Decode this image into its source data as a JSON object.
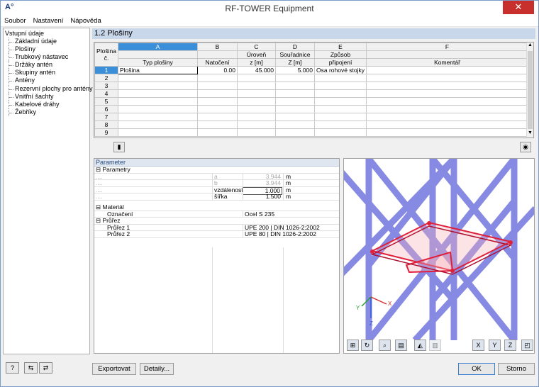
{
  "window": {
    "title": "RF-TOWER Equipment",
    "close": "✕"
  },
  "menu": [
    "Soubor",
    "Nastavení",
    "Nápověda"
  ],
  "tree": {
    "root": "Vstupní údaje",
    "items": [
      "Základní údaje",
      "Plošiny",
      "Trubkový nástavec",
      "Držáky antén",
      "Skupiny antén",
      "Antény",
      "Rezervní plochy pro antény",
      "Vnitřní šachty",
      "Kabelové dráhy",
      "Žebříky"
    ]
  },
  "section_title": "1.2 Plošiny",
  "table": {
    "col_letters": [
      "A",
      "B",
      "C",
      "D",
      "E",
      "F"
    ],
    "row_header": [
      "Plošina",
      "č."
    ],
    "headers": [
      [
        "",
        "Typ plošiny"
      ],
      [
        "",
        "Natočení"
      ],
      [
        "Úroveň",
        "z [m]"
      ],
      [
        "Souřadnice",
        "Z [m]"
      ],
      [
        "Způsob",
        "připojení"
      ],
      [
        "",
        "Komentář"
      ]
    ],
    "rows": [
      {
        "n": "1",
        "a": "Plošina",
        "b": "0.00",
        "c": "45.000",
        "d": "5.000",
        "e": "Osa rohové stojky",
        "f": ""
      },
      {
        "n": "2"
      },
      {
        "n": "3"
      },
      {
        "n": "4"
      },
      {
        "n": "5"
      },
      {
        "n": "6"
      },
      {
        "n": "7"
      },
      {
        "n": "8"
      },
      {
        "n": "9"
      }
    ]
  },
  "params": {
    "title": "Parameter",
    "groups": [
      {
        "name": "Parametry",
        "rows": [
          {
            "label": "....",
            "sym": "a",
            "value": "3.944",
            "unit": "m",
            "greyed": true
          },
          {
            "label": "....",
            "sym": "b",
            "value": "3.944",
            "unit": "m",
            "greyed": true
          },
          {
            "label": "....",
            "sym": "vzdálenost",
            "value": "1.000",
            "unit": "m",
            "greyed": false
          },
          {
            "label": "....",
            "sym": "šířka",
            "value": "1.500",
            "unit": "m",
            "greyed": false
          }
        ]
      },
      {
        "name": "Materiál",
        "rows": [
          {
            "label": "Označení",
            "text": "Ocel  S 235"
          }
        ]
      },
      {
        "name": "Průřez",
        "rows": [
          {
            "label": "Průřez 1",
            "text": "UPE 200 | DIN 1026-2:2002"
          },
          {
            "label": "Průřez 2",
            "text": "UPE 80 | DIN 1026-2:2002"
          }
        ]
      }
    ]
  },
  "axes": {
    "x": "X",
    "y": "Y",
    "z": "Z"
  },
  "buttons": {
    "export": "Exportovat",
    "details": "Detaily...",
    "ok": "OK",
    "cancel": "Storno"
  }
}
